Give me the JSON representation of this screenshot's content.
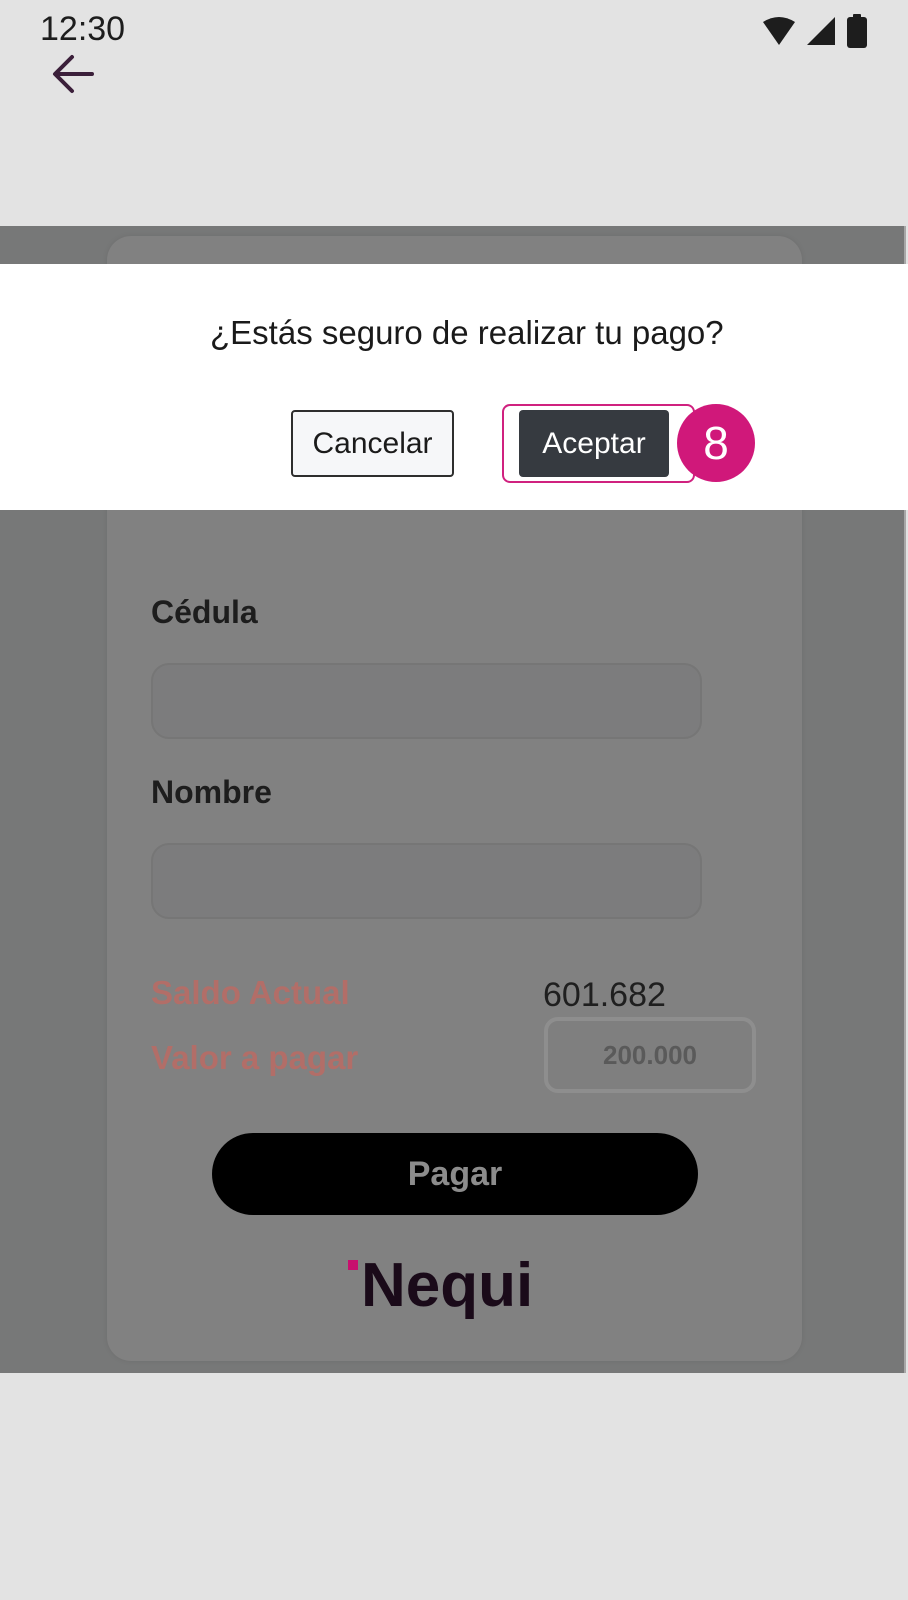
{
  "status_bar": {
    "time": "12:30",
    "icons": [
      "wifi-icon",
      "signal-icon",
      "battery-icon"
    ]
  },
  "toolbar": {
    "back_icon": "arrow-left-icon"
  },
  "dialog": {
    "title": "¿Estás seguro de realizar tu pago?",
    "cancel_label": "Cancelar",
    "accept_label": "Aceptar",
    "step_badge": "8",
    "highlight_color": "#d0217f"
  },
  "form": {
    "cedula_label": "Cédula",
    "cedula_value": "",
    "nombre_label": "Nombre",
    "nombre_value": "",
    "saldo_label": "Saldo Actual",
    "saldo_value": "601.682",
    "valor_label": "Valor a pagar",
    "valor_value": "200.000",
    "pagar_label": "Pagar"
  },
  "brand": {
    "logo_text": "Nequi",
    "accent_color": "#d0187a"
  }
}
